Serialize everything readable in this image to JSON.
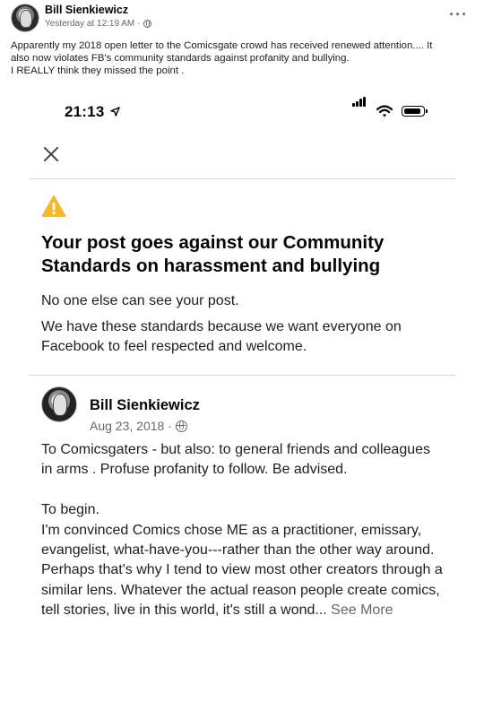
{
  "outer_post": {
    "author": "Bill Sienkiewicz",
    "timestamp": "Yesterday at 12:19 AM",
    "meta_separator": "·",
    "more_label": "···",
    "text_lines": [
      "Apparently my 2018 open letter to the Comicsgate crowd has received renewed attention.... It",
      "also now violates FB's community standards against profanity and bullying.",
      "I REALLY think they missed the point ."
    ]
  },
  "screenshot": {
    "status_bar": {
      "time": "21:13"
    },
    "notice": {
      "title": "Your post goes against our Community Standards on harassment and bullying",
      "line1": "No one else can see your post.",
      "line2": "We have these standards because we want everyone on Facebook to feel respected and welcome."
    },
    "inner_post": {
      "author": "Bill Sienkiewicz",
      "date": "Aug 23, 2018",
      "meta_separator": "·",
      "paragraph1": "To Comicsgaters - but also: to general friends and colleagues in arms . Profuse profanity to follow. Be advised.",
      "paragraph2_l1": "To begin.",
      "paragraph2_l2": "I'm convinced Comics chose ME as a practitioner, emissary, evangelist, what-have-you---rather than the other way around.",
      "paragraph2_l3": "Perhaps that's why I tend to view most other creators through a similar lens. Whatever the actual reason people create comics, tell stories, live in this world, it's still a wond...",
      "see_more": "See More"
    }
  },
  "colors": {
    "warning": "#f7b928",
    "secondary_text": "#65676b",
    "divider": "#d4d4d4"
  }
}
